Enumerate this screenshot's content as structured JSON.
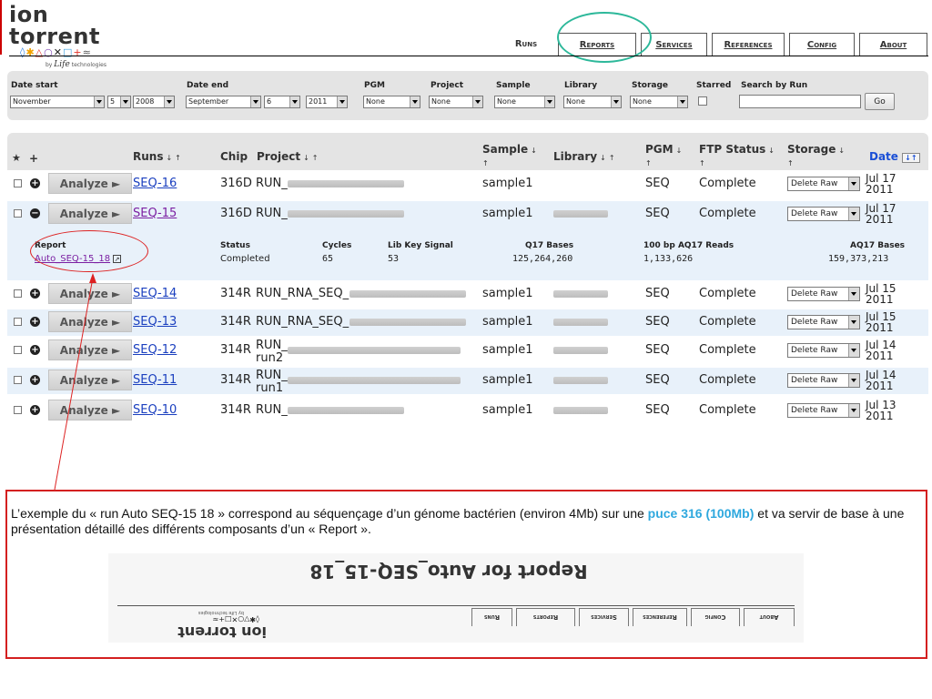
{
  "brand": {
    "name": "ion torrent",
    "glyphs": [
      {
        "char": "◊",
        "color": "#2a7de1"
      },
      {
        "char": "✱",
        "color": "#f1a100"
      },
      {
        "char": "△",
        "color": "#e0342a"
      },
      {
        "char": "○",
        "color": "#7a3fb0"
      },
      {
        "char": "✕",
        "color": "#1a1a1a"
      },
      {
        "char": "□",
        "color": "#3aa0e0"
      },
      {
        "char": "+",
        "color": "#e0342a"
      },
      {
        "char": "≈",
        "color": "#555555"
      }
    ],
    "sub_prefix": "by",
    "sub_brand": "Life",
    "sub_suffix": "technologies"
  },
  "tabs": [
    {
      "label": "Runs",
      "active": true,
      "width": 60
    },
    {
      "label": "Reports",
      "active": false,
      "width": 86
    },
    {
      "label": "Services",
      "active": false,
      "width": 73
    },
    {
      "label": "References",
      "active": false,
      "width": 80
    },
    {
      "label": "Config",
      "active": false,
      "width": 72
    },
    {
      "label": "About",
      "active": false,
      "width": 75
    }
  ],
  "filters": {
    "date_start_label": "Date start",
    "date_start_month": "November",
    "date_start_day": "5",
    "date_start_year": "2008",
    "date_end_label": "Date end",
    "date_end_month": "September",
    "date_end_day": "6",
    "date_end_year": "2011",
    "pgm_label": "PGM",
    "pgm_value": "None",
    "project_label": "Project",
    "project_value": "None",
    "sample_label": "Sample",
    "sample_value": "None",
    "library_label": "Library",
    "library_value": "None",
    "storage_label": "Storage",
    "storage_value": "None",
    "starred_label": "Starred",
    "search_label": "Search by Run",
    "search_value": "",
    "go_label": "Go"
  },
  "table": {
    "headers": {
      "star": "★",
      "plus": "+",
      "runs": "Runs",
      "chip": "Chip",
      "project": "Project",
      "sample": "Sample",
      "library": "Library",
      "pgm": "PGM",
      "ftp": "FTP Status",
      "storage": "Storage",
      "date": "Date",
      "sort_down": "↓",
      "sort_up": "↑"
    },
    "analyze_label": "Analyze ►",
    "rows": [
      {
        "run": "SEQ-16",
        "chip": "316D",
        "project": "RUN_",
        "project_line2": "",
        "sample": "sample1",
        "pgm": "SEQ",
        "ftp": "Complete",
        "storage": "Delete Raw",
        "date_line1": "Jul 17",
        "date_line2": "2011",
        "expanded": false
      },
      {
        "run": "SEQ-15",
        "chip": "316D",
        "project": "RUN_",
        "project_line2": "",
        "sample": "sample1",
        "pgm": "SEQ",
        "ftp": "Complete",
        "storage": "Delete Raw",
        "date_line1": "Jul 17",
        "date_line2": "2011",
        "expanded": true
      },
      {
        "run": "SEQ-14",
        "chip": "314R",
        "project": "RUN_RNA_SEQ_",
        "project_line2": "",
        "sample": "sample1",
        "pgm": "SEQ",
        "ftp": "Complete",
        "storage": "Delete Raw",
        "date_line1": "Jul 15",
        "date_line2": "2011",
        "expanded": false
      },
      {
        "run": "SEQ-13",
        "chip": "314R",
        "project": "RUN_RNA_SEQ_",
        "project_line2": "",
        "sample": "sample1",
        "pgm": "SEQ",
        "ftp": "Complete",
        "storage": "Delete Raw",
        "date_line1": "Jul 15",
        "date_line2": "2011",
        "expanded": false
      },
      {
        "run": "SEQ-12",
        "chip": "314R",
        "project": "RUN_",
        "project_line2": "run2",
        "sample": "sample1",
        "pgm": "SEQ",
        "ftp": "Complete",
        "storage": "Delete Raw",
        "date_line1": "Jul 14",
        "date_line2": "2011",
        "expanded": false
      },
      {
        "run": "SEQ-11",
        "chip": "314R",
        "project": "RUN_",
        "project_line2": "run1",
        "sample": "sample1",
        "pgm": "SEQ",
        "ftp": "Complete",
        "storage": "Delete Raw",
        "date_line1": "Jul 14",
        "date_line2": "2011",
        "expanded": false
      },
      {
        "run": "SEQ-10",
        "chip": "314R",
        "project": "RUN_",
        "project_line2": "",
        "sample": "sample1",
        "pgm": "SEQ",
        "ftp": "Complete",
        "storage": "Delete Raw",
        "date_line1": "Jul 13",
        "date_line2": "2011",
        "expanded": false
      }
    ]
  },
  "report_panel": {
    "report_label": "Report",
    "report_link": "Auto_SEQ-15_18",
    "status_label": "Status",
    "status_value": "Completed",
    "cycles_label": "Cycles",
    "cycles_value": "65",
    "libkey_label": "Lib Key Signal",
    "libkey_value": "53",
    "q17_label": "Q17 Bases",
    "q17_value": "125,264,260",
    "aq17reads_label": "100 bp AQ17 Reads",
    "aq17reads_value": "1,133,626",
    "aq17bases_label": "AQ17 Bases",
    "aq17bases_value": "159,373,213"
  },
  "annotation": {
    "text_part1": "L’exemple du « run Auto SEQ-15 18 » correspond au séquençage d’un génome bactérien (environ 4Mb) sur une ",
    "highlight": "puce 316 (100Mb)",
    "text_part2": " et va servir de base à une présentation détaillé des différents composants d’un « Report ».",
    "mirror_title": "Report for Auto_SEQ-15_18",
    "mirror_logo": "ion torrent",
    "mirror_glyphs": "◊✱▽○✕□+≈",
    "mirror_sub": "by Life technologies",
    "colors": {
      "border": "#d42020",
      "highlight": "#2ea8de"
    }
  },
  "colors": {
    "tab_highlight_ring": "#2db89a",
    "report_callout": "#d22222",
    "link": "#1a3fbf",
    "visited_link": "#7b1fa2",
    "alt_row": "#e8f1fa"
  }
}
